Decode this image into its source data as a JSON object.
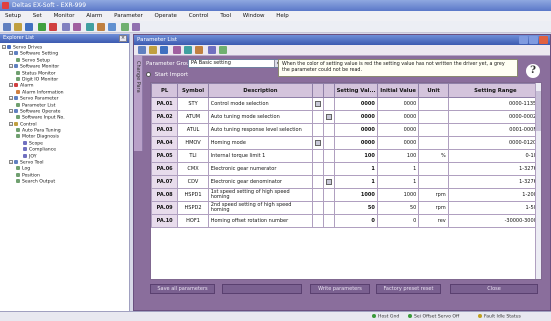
{
  "app": {
    "title": "Deltas EX-Soft - EXR-999"
  },
  "menu": [
    "Setup",
    "Set",
    "Monitor",
    "Alarm",
    "Parameter",
    "Operate",
    "Control",
    "Tool",
    "Window",
    "Help"
  ],
  "left_pane": {
    "title": "Explorer List",
    "tree": [
      {
        "label": "Servo Drives",
        "level": 0,
        "color": "#4a70c0"
      },
      {
        "label": "Software Setting",
        "level": 1,
        "color": "#6080c0"
      },
      {
        "label": "Servo Setup",
        "level": 2,
        "color": "#70a070"
      },
      {
        "label": "Software Monitor",
        "level": 1,
        "color": "#6080c0"
      },
      {
        "label": "Status Monitor",
        "level": 2,
        "color": "#70a070"
      },
      {
        "label": "Digit IO Monitor",
        "level": 2,
        "color": "#70a070"
      },
      {
        "label": "Alarm",
        "level": 1,
        "color": "#d04040"
      },
      {
        "label": "Alarm Information",
        "level": 2,
        "color": "#d08040"
      },
      {
        "label": "Servo Parameter",
        "level": 1,
        "color": "#6080c0"
      },
      {
        "label": "Parameter List",
        "level": 2,
        "color": "#70a070"
      },
      {
        "label": "Software Operate",
        "level": 1,
        "color": "#6080c0"
      },
      {
        "label": "Software Input No.",
        "level": 2,
        "color": "#70a070"
      },
      {
        "label": "Control",
        "level": 1,
        "color": "#c0a040"
      },
      {
        "label": "Auto Para Tuning",
        "level": 2,
        "color": "#70a070"
      },
      {
        "label": "Motor Diagnosis",
        "level": 2,
        "color": "#70a070"
      },
      {
        "label": "Scope",
        "level": 3,
        "color": "#7070c0"
      },
      {
        "label": "Compliance",
        "level": 3,
        "color": "#7070c0"
      },
      {
        "label": "JOY",
        "level": 3,
        "color": "#7070c0"
      },
      {
        "label": "Servo Tool",
        "level": 1,
        "color": "#6080c0"
      },
      {
        "label": "Log",
        "level": 2,
        "color": "#70a070"
      },
      {
        "label": "Position",
        "level": 2,
        "color": "#70a070"
      },
      {
        "label": "Search Output",
        "level": 2,
        "color": "#70a070"
      }
    ]
  },
  "param_window": {
    "title": "Parameter List",
    "side_tab": "Change Para",
    "group_label": "Parameter Group",
    "group_value": "PA Basic setting",
    "radio_label": "Start Import",
    "note": "When the color of setting value is red the setting value has not written the driver yet, a grey the parameter could not be read.",
    "columns": [
      "PL",
      "Symbol",
      "Description",
      "",
      "",
      "Setting Val...",
      "Initial Value",
      "Unit",
      "Setting Range"
    ],
    "rows": [
      {
        "no": "PA.01",
        "sym": "STY",
        "desc": "Control mode selection",
        "cb1": true,
        "cb2": false,
        "set": "0000",
        "init": "0000",
        "unit": "",
        "range": "0000-1135H"
      },
      {
        "no": "PA.02",
        "sym": "ATUM",
        "desc": "Auto tuning mode selection",
        "cb1": false,
        "cb2": true,
        "set": "0000",
        "init": "0000",
        "unit": "",
        "range": "0000-0002H"
      },
      {
        "no": "PA.03",
        "sym": "ATUL",
        "desc": "Auto tuning response level selection",
        "cb1": false,
        "cb2": false,
        "set": "0000",
        "init": "0000",
        "unit": "",
        "range": "0001-000FH"
      },
      {
        "no": "PA.04",
        "sym": "HMOV",
        "desc": "Homing mode",
        "cb1": true,
        "cb2": false,
        "set": "0000",
        "init": "0000",
        "unit": "",
        "range": "0000-0120H"
      },
      {
        "no": "PA.05",
        "sym": "TLI",
        "desc": "Internal torque limit 1",
        "cb1": false,
        "cb2": false,
        "set": "100",
        "init": "100",
        "unit": "%",
        "range": "0-100"
      },
      {
        "no": "PA.06",
        "sym": "CMX",
        "desc": "Electronic gear numerator",
        "cb1": false,
        "cb2": false,
        "set": "1",
        "init": "1",
        "unit": "",
        "range": "1-32767"
      },
      {
        "no": "PA.07",
        "sym": "CDV",
        "desc": "Electronic gear denominator",
        "cb1": false,
        "cb2": true,
        "set": "1",
        "init": "1",
        "unit": "",
        "range": "1-32767"
      },
      {
        "no": "PA.08",
        "sym": "HSPD1",
        "desc": "1st speed setting of high speed homing",
        "cb1": false,
        "cb2": false,
        "set": "1000",
        "init": "1000",
        "unit": "rpm",
        "range": "1-2000"
      },
      {
        "no": "PA.09",
        "sym": "HSPD2",
        "desc": "2nd speed setting of high speed homing",
        "cb1": false,
        "cb2": false,
        "set": "50",
        "init": "50",
        "unit": "rpm",
        "range": "1-500"
      },
      {
        "no": "PA.10",
        "sym": "HOF1",
        "desc": "Homing offset rotation number",
        "cb1": false,
        "cb2": false,
        "set": "0",
        "init": "0",
        "unit": "rev",
        "range": "-30000-30000"
      }
    ],
    "buttons": {
      "save": "Save all parameters",
      "blank": "",
      "write": "Write parameters",
      "reset": "Factory preset reset",
      "close": "Close"
    }
  },
  "statusbar": {
    "items": [
      "Host Gnd",
      "Sei Offset Servo Off",
      "Fault Idle Status"
    ],
    "led_colors": [
      "#3a9a3a",
      "#3a9a3a",
      "#c0a020"
    ]
  }
}
